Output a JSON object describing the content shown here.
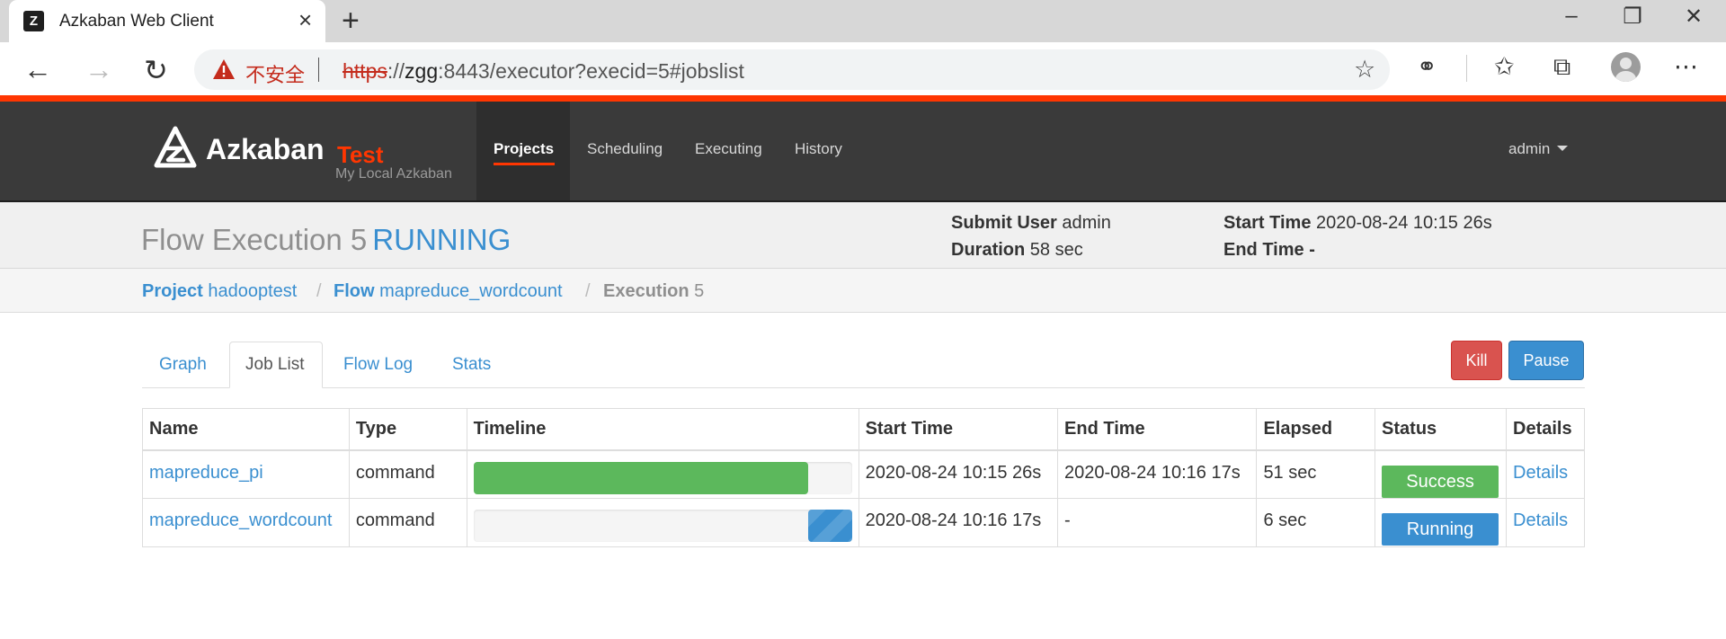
{
  "browser": {
    "tab_title": "Azkaban Web Client",
    "insecure_label": "不安全",
    "url_scheme": "https",
    "url_sep": "://",
    "url_host": "zgg",
    "url_rest": ":8443/executor?execid=5#jobslist",
    "colors": {
      "insecure": "#c42b1c"
    }
  },
  "navbar": {
    "brand": "Azkaban",
    "env": "Test",
    "subtitle": "My Local Azkaban",
    "items": [
      {
        "label": "Projects",
        "active": true
      },
      {
        "label": "Scheduling",
        "active": false
      },
      {
        "label": "Executing",
        "active": false
      },
      {
        "label": "History",
        "active": false
      }
    ],
    "user": "admin",
    "colors": {
      "accent": "#ff3601",
      "bar": "#3a3a3a"
    }
  },
  "header": {
    "title_prefix": "Flow Execution 5",
    "status": "RUNNING",
    "submit_user_label": "Submit User",
    "submit_user": "admin",
    "duration_label": "Duration",
    "duration": "58 sec",
    "start_time_label": "Start Time",
    "start_time": "2020-08-24 10:15 26s",
    "end_time_label": "End Time",
    "end_time": "-"
  },
  "breadcrumb": {
    "project_label": "Project",
    "project": "hadooptest",
    "flow_label": "Flow",
    "flow": "mapreduce_wordcount",
    "execution_label": "Execution",
    "execution": "5",
    "separator": "/"
  },
  "tabs": [
    "Graph",
    "Job List",
    "Flow Log",
    "Stats"
  ],
  "active_tab": "Job List",
  "actions": {
    "kill": "Kill",
    "pause": "Pause"
  },
  "table": {
    "headers": [
      "Name",
      "Type",
      "Timeline",
      "Start Time",
      "End Time",
      "Elapsed",
      "Status",
      "Details"
    ],
    "rows": [
      {
        "name": "mapreduce_pi",
        "type": "command",
        "timeline_start": 0.0,
        "timeline_end": 0.885,
        "start_time": "2020-08-24 10:15 26s",
        "end_time": "2020-08-24 10:16 17s",
        "elapsed": "51 sec",
        "status": "Success",
        "details": "Details"
      },
      {
        "name": "mapreduce_wordcount",
        "type": "command",
        "timeline_start": 0.885,
        "timeline_end": 1.0,
        "start_time": "2020-08-24 10:16 17s",
        "end_time": "-",
        "elapsed": "6 sec",
        "status": "Running",
        "details": "Details"
      }
    ],
    "colors": {
      "success": "#5cb85c",
      "running": "#3a8fd0",
      "link": "#3a8fd0"
    }
  }
}
